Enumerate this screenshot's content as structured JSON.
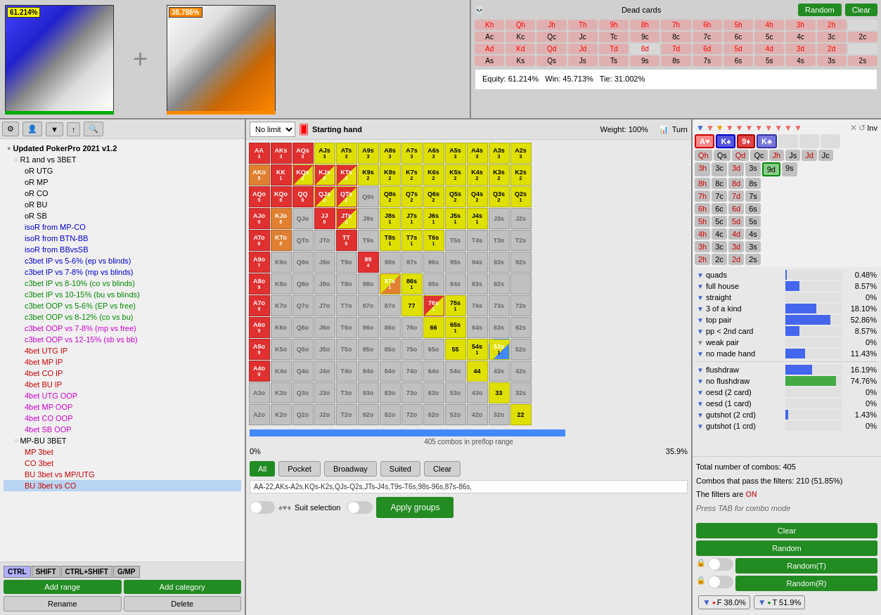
{
  "top": {
    "equity1": "61.214%",
    "equity2": "38.786%",
    "deadCards": "Dead cards",
    "btnRandom": "Random",
    "btnClear": "Clear",
    "equity": {
      "label": "Equity: 61.214%",
      "win": "Win: 45.713%",
      "tie": "Tie: 31.002%"
    },
    "cardRows": [
      [
        "Kh",
        "Qh",
        "Jh",
        "Th",
        "9h",
        "8h",
        "7h",
        "6h",
        "5h",
        "4h",
        "3h",
        "2h"
      ],
      [
        "Ac",
        "Kc",
        "Qc",
        "Jc",
        "Tc",
        "9c",
        "8c",
        "7c",
        "6c",
        "5c",
        "4c",
        "3c",
        "2c"
      ],
      [
        "Ad",
        "Kd",
        "Qd",
        "Jd",
        "Td",
        "8d",
        "7d",
        "6d",
        "5d",
        "4d",
        "3d",
        "2d"
      ],
      [
        "As",
        "Ks",
        "Qs",
        "Js",
        "Ts",
        "9s",
        "8s",
        "7s",
        "6s",
        "5s",
        "4s",
        "3s",
        "2s"
      ]
    ]
  },
  "toolbar": {
    "settings_label": "⚙",
    "user_label": "👤",
    "filter_label": "▼",
    "share_label": "↑",
    "search_label": "🔍"
  },
  "tree": {
    "title": "Updated PokerPro 2021 v1.2",
    "items": [
      {
        "label": "R1 and vs 3BET",
        "level": 1,
        "color": ""
      },
      {
        "label": "oR UTG",
        "level": 2,
        "color": ""
      },
      {
        "label": "oR MP",
        "level": 2,
        "color": ""
      },
      {
        "label": "oR CO",
        "level": 2,
        "color": ""
      },
      {
        "label": "oR BU",
        "level": 2,
        "color": ""
      },
      {
        "label": "oR SB",
        "level": 2,
        "color": ""
      },
      {
        "label": "isoR from MP-CO",
        "level": 2,
        "color": "blue"
      },
      {
        "label": "isoR from BTN-BB",
        "level": 2,
        "color": "blue"
      },
      {
        "label": "isoR from BBvsSB",
        "level": 2,
        "color": "blue"
      },
      {
        "label": "c3bet IP vs 5-6% (ep vs blinds)",
        "level": 2,
        "color": "blue"
      },
      {
        "label": "c3bet IP vs 7-8% (mp vs blinds)",
        "level": 2,
        "color": "blue"
      },
      {
        "label": "c3bet IP vs 8-10% (co vs blinds)",
        "level": 2,
        "color": "green"
      },
      {
        "label": "c3bet IP vs 10-15% (bu vs blinds)",
        "level": 2,
        "color": "green"
      },
      {
        "label": "c3bet OOP vs 5-6% (EP vs free)",
        "level": 2,
        "color": "green"
      },
      {
        "label": "c3bet OOP vs 8-12% (co vs bu)",
        "level": 2,
        "color": "green"
      },
      {
        "label": "c3bet OOP vs 7-8% (mp vs free)",
        "level": 2,
        "color": "magenta"
      },
      {
        "label": "c3bet OOP vs 12-15% (sb vs bb)",
        "level": 2,
        "color": "magenta"
      },
      {
        "label": "4bet UTG IP",
        "level": 2,
        "color": "red"
      },
      {
        "label": "4bet MP IP",
        "level": 2,
        "color": "red"
      },
      {
        "label": "4bet CO IP",
        "level": 2,
        "color": "red"
      },
      {
        "label": "4bet BU IP",
        "level": 2,
        "color": "red"
      },
      {
        "label": "4bet UTG OOP",
        "level": 2,
        "color": "magenta"
      },
      {
        "label": "4bet MP OOP",
        "level": 2,
        "color": "magenta"
      },
      {
        "label": "4bet CO OOP",
        "level": 2,
        "color": "magenta"
      },
      {
        "label": "4bet SB OOP",
        "level": 2,
        "color": "magenta"
      },
      {
        "label": "MP-BU 3BET",
        "level": 1,
        "color": ""
      },
      {
        "label": "MP 3bet",
        "level": 2,
        "color": "red"
      },
      {
        "label": "CO 3bet",
        "level": 2,
        "color": "red"
      },
      {
        "label": "BU 3bet vs MP/UTG",
        "level": 2,
        "color": "red"
      },
      {
        "label": "BU 3bet vs CO",
        "level": 2,
        "color": "red"
      }
    ],
    "btnAddRange": "Add range",
    "btnAddCategory": "Add category",
    "btnRename": "Rename",
    "btnDelete": "Delete",
    "shortcuts": [
      "CTRL",
      "SHIFT",
      "CTRL+SHIFT",
      "G/MP"
    ]
  },
  "matrix": {
    "header": {
      "limitType": "No limit",
      "startingHand": "Starting hand",
      "weight": "Weight:",
      "weightValue": "100%",
      "turn": "Turn"
    },
    "combosInfo": "405 combos in preflop range",
    "rangePercent": "35.9%",
    "zeroPercent": "0%",
    "rangeString": "AA-22,AKs-A2s,KQs-K2s,QJs-Q2s,JTs-J4s,T9s-T6s,98s-96s,87s-86s,",
    "filterButtons": {
      "all": "All",
      "pocket": "Pocket",
      "broadway": "Broadway",
      "suited": "Suited",
      "clear": "Clear"
    },
    "toggles": {
      "suitSelection": "Suit selection",
      "applyGroups": "Apply groups"
    }
  },
  "rightPanel": {
    "turnLabel": "Turn",
    "invLabel": "Inv",
    "stats": [
      {
        "label": "quads",
        "pct": "0.48%",
        "barWidth": 3
      },
      {
        "label": "full house",
        "pct": "8.57%",
        "barWidth": 25
      },
      {
        "label": "straight",
        "pct": "0%",
        "barWidth": 0
      },
      {
        "label": "3 of a kind",
        "pct": "18.10%",
        "barWidth": 55,
        "highlighted": true
      },
      {
        "label": "top pair",
        "pct": "52.86%",
        "barWidth": 80,
        "highlighted": true
      },
      {
        "label": "pp < 2nd card",
        "pct": "8.57%",
        "barWidth": 25
      },
      {
        "label": "weak pair",
        "pct": "0%",
        "barWidth": 0
      },
      {
        "label": "no made hand",
        "pct": "11.43%",
        "barWidth": 35
      },
      {
        "label": "flushdraw",
        "pct": "16.19%",
        "barWidth": 48
      },
      {
        "label": "no flushdraw",
        "pct": "74.76%",
        "barWidth": 90,
        "green": true
      },
      {
        "label": "oesd (2 card)",
        "pct": "0%",
        "barWidth": 0
      },
      {
        "label": "oesd (1 card)",
        "pct": "0%",
        "barWidth": 0
      },
      {
        "label": "gutshot (2 crd)",
        "pct": "1.43%",
        "barWidth": 5
      },
      {
        "label": "gutshot (1 crd)",
        "pct": "0%",
        "barWidth": 0
      }
    ],
    "comboInfo": {
      "total": "Total number of combos: 405",
      "passing": "Combos that pass the filters: 210 (51.85%)",
      "filtersOn": "The filters are ON",
      "tabHint": "Press TAB for combo mode"
    },
    "buttons": {
      "clear": "Clear",
      "random": "Random",
      "randomT": "Random(T)",
      "randomR": "Random(R)"
    },
    "filterIndicators": {
      "left": "F 38.0%",
      "right": "T 51.9%"
    }
  }
}
